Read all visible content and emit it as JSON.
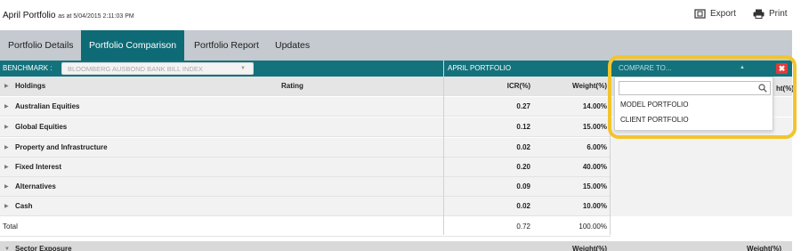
{
  "header": {
    "title": "April Portfolio",
    "subtitle": "as at 5/04/2015 2:11:03 PM",
    "export_label": "Export",
    "print_label": "Print"
  },
  "tabs": [
    {
      "label": "Portfolio Details",
      "active": false
    },
    {
      "label": "Portfolio Comparison",
      "active": true
    },
    {
      "label": "Portfolio Report",
      "active": false
    },
    {
      "label": "Updates",
      "active": false
    }
  ],
  "benchmark": {
    "label": "BENCHMARK :",
    "selected": "BLOOMBERG AUSBOND BANK BILL INDEX"
  },
  "portfolio_column": "APRIL PORTFOLIO",
  "compare": {
    "label": "COMPARE TO...",
    "search_value": "",
    "options": [
      "MODEL PORTFOLIO",
      "CLIENT PORTFOLIO"
    ],
    "right_header_fragment": "ht(%)"
  },
  "table": {
    "headers": {
      "holdings": "Holdings",
      "rating": "Rating",
      "icr": "ICR(%)",
      "weight": "Weight(%)"
    },
    "rows": [
      {
        "name": "Australian Equities",
        "icr": "0.27",
        "weight": "14.00%"
      },
      {
        "name": "Global Equities",
        "icr": "0.12",
        "weight": "15.00%"
      },
      {
        "name": "Property and Infrastructure",
        "icr": "0.02",
        "weight": "6.00%"
      },
      {
        "name": "Fixed Interest",
        "icr": "0.20",
        "weight": "40.00%"
      },
      {
        "name": "Alternatives",
        "icr": "0.09",
        "weight": "15.00%"
      },
      {
        "name": "Cash",
        "icr": "0.02",
        "weight": "10.00%"
      }
    ],
    "total": {
      "label": "Total",
      "icr": "0.72",
      "weight": "100.00%"
    }
  },
  "sector": {
    "label": "Sector Exposure",
    "weight_header": "Weight(%)",
    "weight_header_right": "Weight(%)"
  },
  "colors": {
    "accent": "#0e6b76",
    "tab_bar": "#c4cacf",
    "highlight": "#f2c52e",
    "close": "#e23b3b"
  }
}
